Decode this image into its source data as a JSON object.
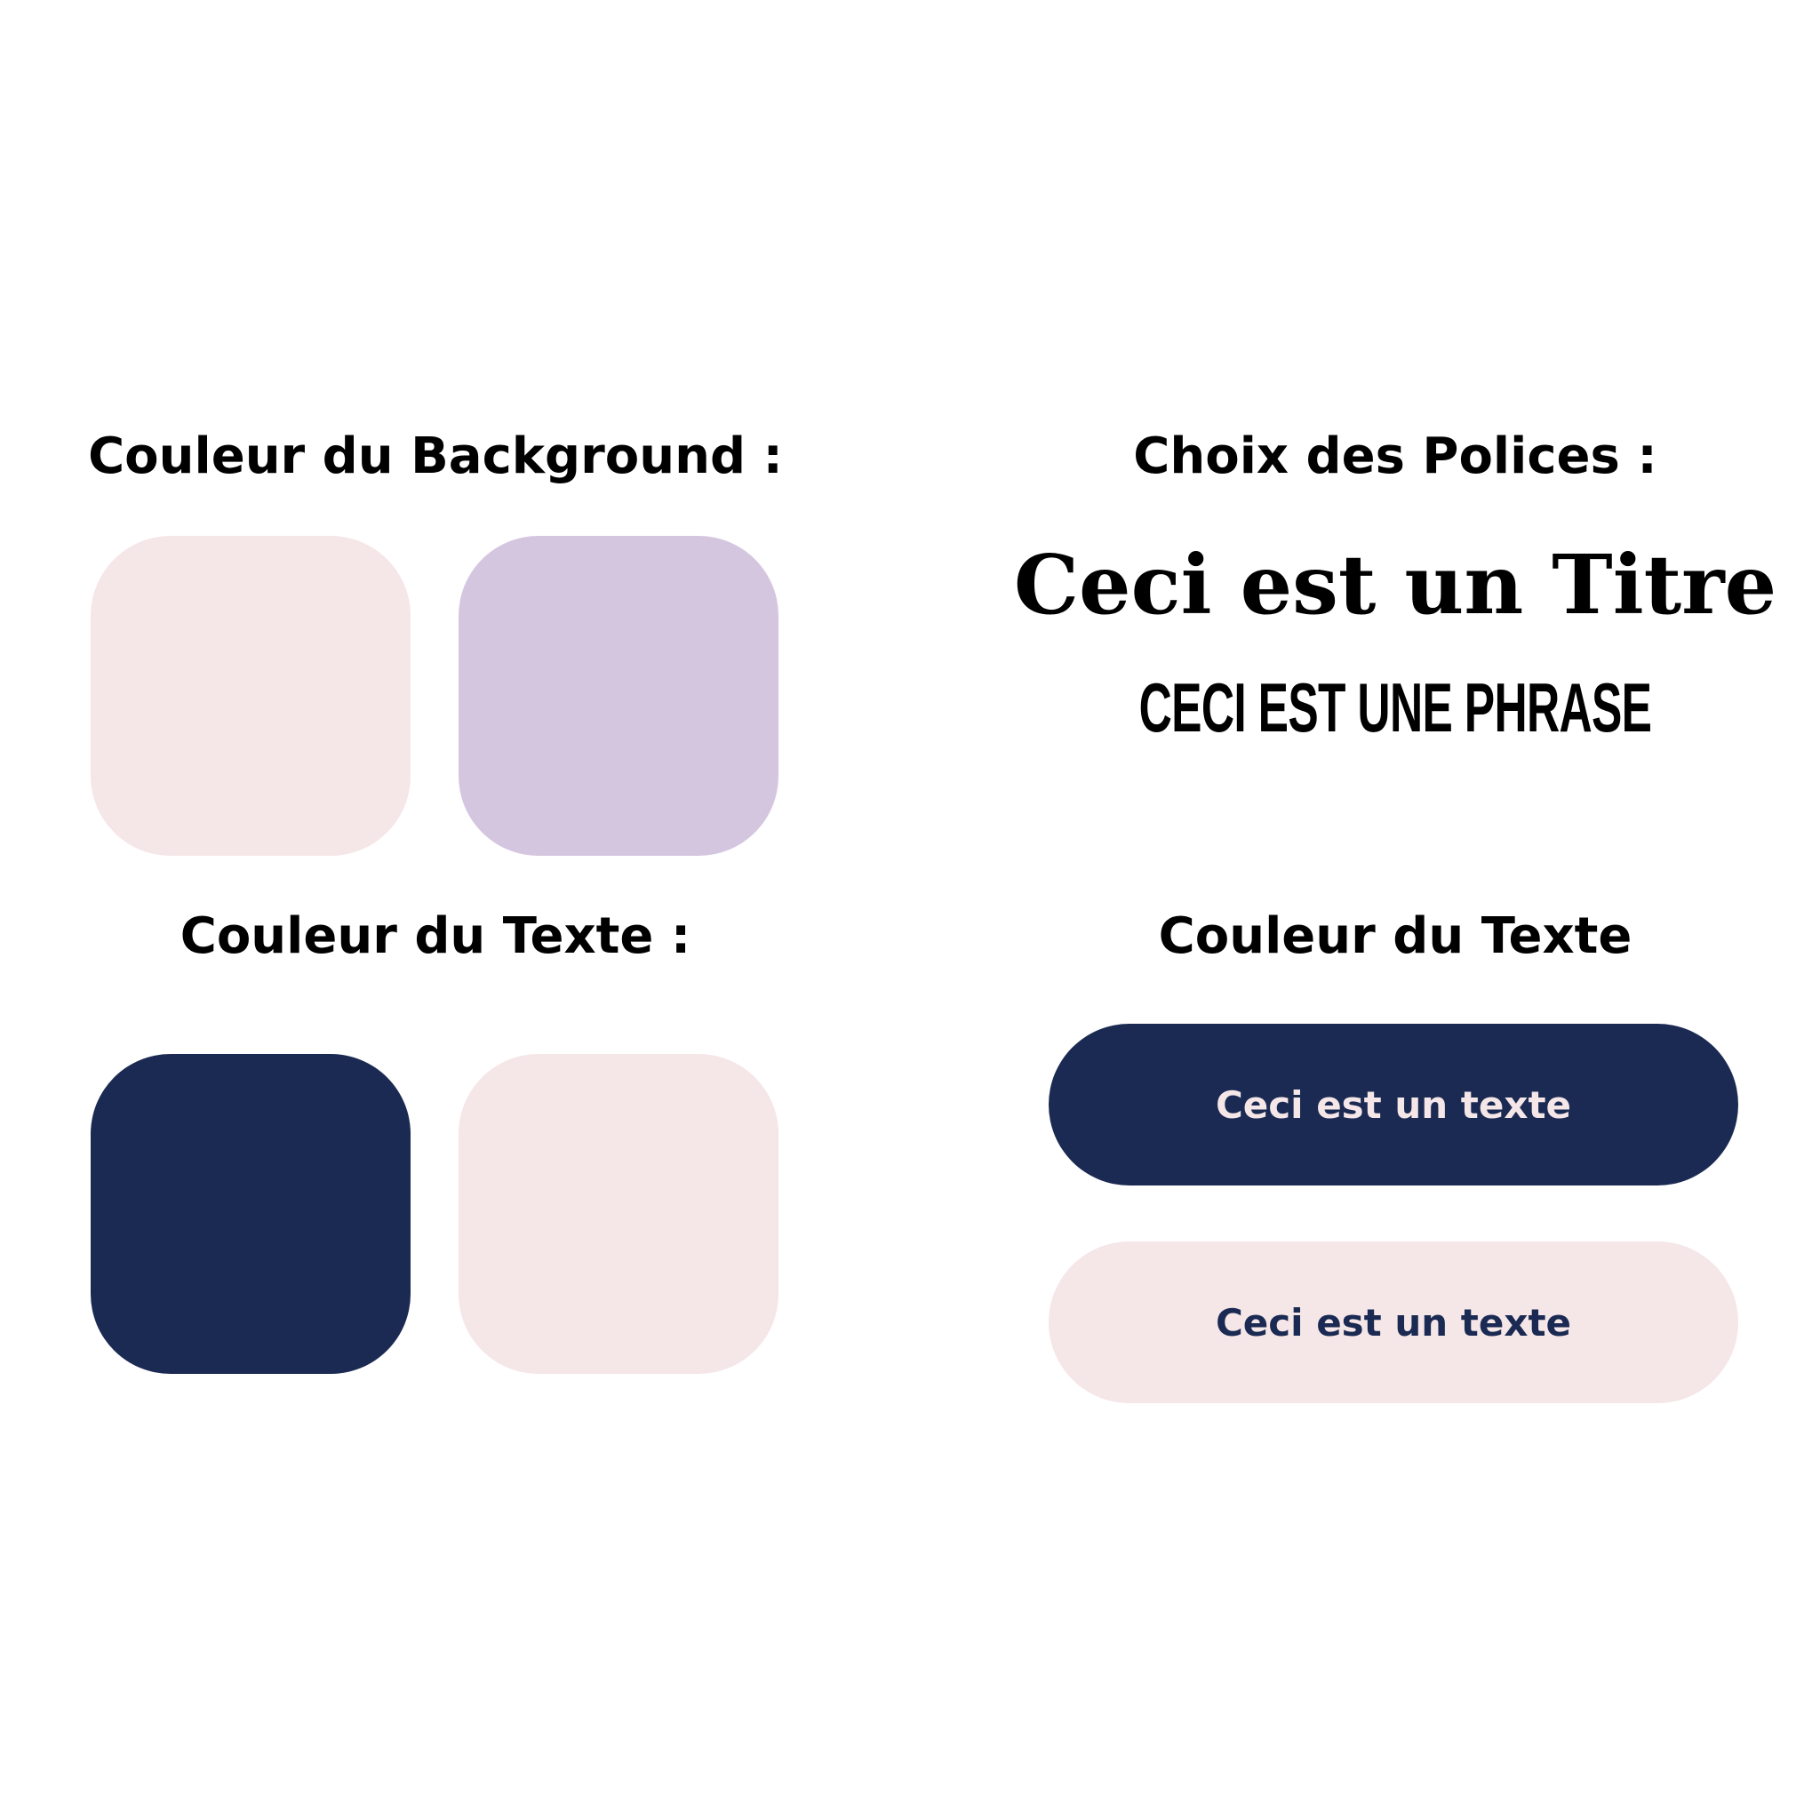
{
  "colors": {
    "pink": "#f5e6e8",
    "lavender": "#d5c6e0",
    "navy": "#1b2a52"
  },
  "background_section": {
    "heading": "Couleur du Background :",
    "swatches": [
      "#f5e6e8",
      "#d5c6e0"
    ]
  },
  "fonts_section": {
    "heading": "Choix des Polices :",
    "title_sample": "Ceci est un Titre",
    "phrase_sample": "CECI EST UNE PHRASE"
  },
  "text_color_section": {
    "heading": "Couleur du Texte :",
    "swatches": [
      "#1b2a52",
      "#f5e6e8"
    ]
  },
  "text_color_demo": {
    "heading": "Couleur du Texte",
    "pill_dark_label": "Ceci est un texte",
    "pill_light_label": "Ceci est un texte"
  }
}
